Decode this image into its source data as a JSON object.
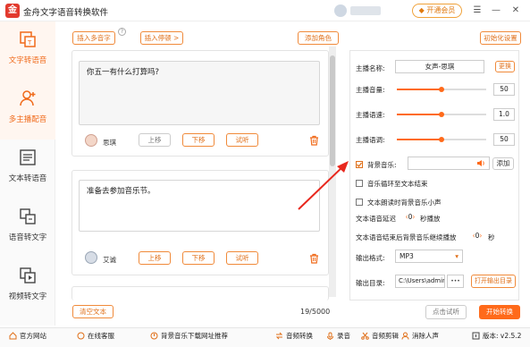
{
  "app": {
    "title": "金舟文字语音转换软件",
    "vip_label": "开通会员"
  },
  "sidebar": {
    "items": [
      {
        "label": "文字转语音",
        "active": true
      },
      {
        "label": "多主播配音",
        "active": true
      },
      {
        "label": "文本转语音",
        "active": false
      },
      {
        "label": "语音转文字",
        "active": false
      },
      {
        "label": "视频转文字",
        "active": false
      }
    ]
  },
  "toolbar": {
    "insert_polyphone": "插入多音字",
    "help_glyph": "?",
    "insert_pause": "插入停顿 >",
    "add_role": "添加角色"
  },
  "cards": [
    {
      "text": "你五一有什么打算吗?",
      "speaker": "思琪",
      "up": "上移",
      "down": "下移",
      "listen": "试听"
    },
    {
      "text": "准备去参加音乐节。",
      "speaker": "艾诚",
      "up": "上移",
      "down": "下移",
      "listen": "试听"
    }
  ],
  "footer": {
    "clear": "清空文本",
    "counter": "19/5000"
  },
  "settings": {
    "init_button": "初始化设置",
    "anchor_name_label": "主播名称:",
    "anchor_name_value": "女声-思琪",
    "change_button": "更换",
    "volume_label": "主播音量:",
    "volume_value": "50",
    "speed_label": "主播语速:",
    "speed_value": "1.0",
    "pitch_label": "主播语调:",
    "pitch_value": "50",
    "bgm_label": "背景音乐:",
    "bgm_add": "添加",
    "loop_label": "音乐循环至文本结束",
    "duck_label": "文本朗读时背景音乐小声",
    "delay_prefix": "文本语音延迟",
    "delay_value": "0",
    "delay_suffix": "秒播放",
    "tail_prefix": "文本语音结束后背景音乐继续播放",
    "tail_value": "0",
    "tail_suffix": "秒",
    "format_label": "输出格式:",
    "format_value": "MP3",
    "dir_label": "输出目录:",
    "dir_value": "C:\\Users\\admir",
    "dir_more": "•••",
    "open_dir": "打开输出目录",
    "preview_button": "点击试听",
    "convert_button": "开始转换"
  },
  "bottom": {
    "website": "官方网站",
    "service": "在线客服",
    "bgm_download": "背景音乐下载网址推荐",
    "audio_convert": "音频转换",
    "record": "录音",
    "audio_cut": "音频剪辑",
    "vocal_remove": "消除人声",
    "version": "版本: v2.5.2"
  },
  "colors": {
    "accent": "#ff6a1a",
    "red_logo": "#e23a2e"
  }
}
